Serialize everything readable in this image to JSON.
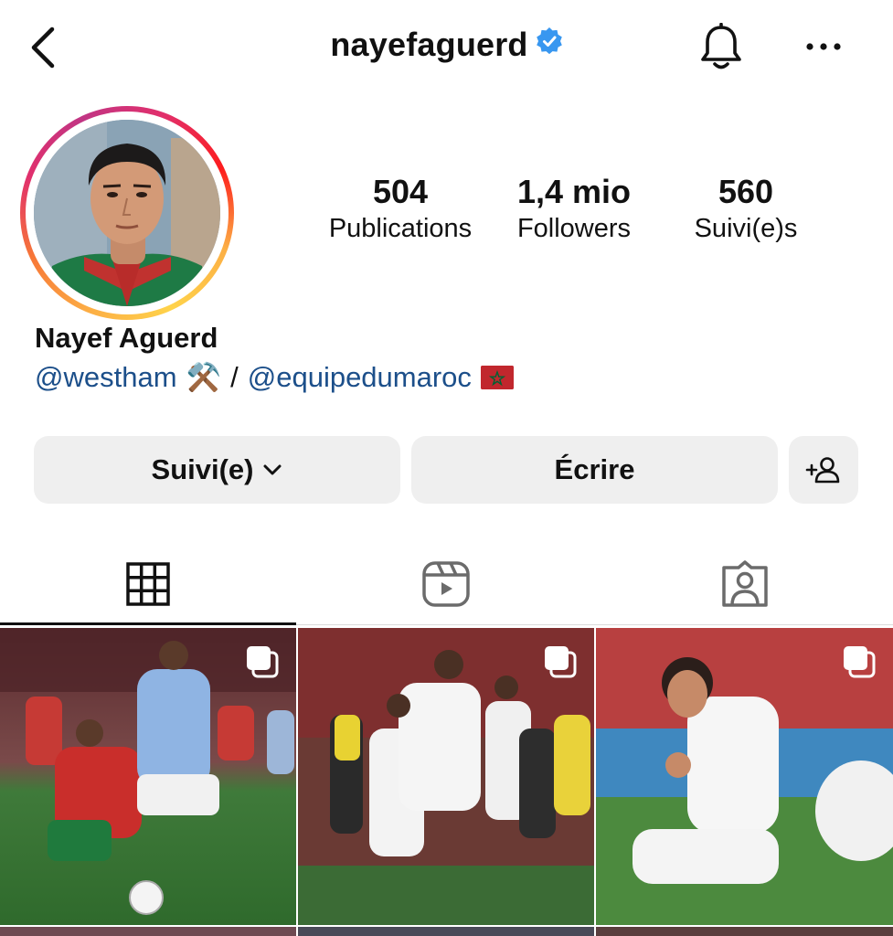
{
  "header": {
    "username": "nayefaguerd",
    "back_icon": "chevron-left-icon",
    "verified_icon": "verified-badge-icon",
    "bell_icon": "bell-icon",
    "more_icon": "more-horizontal-icon",
    "verified_color": "#3897f0"
  },
  "profile": {
    "stats": [
      {
        "value": "504",
        "label": "Publications"
      },
      {
        "value": "1,4 mio",
        "label": "Followers"
      },
      {
        "value": "560",
        "label": "Suivi(e)s"
      }
    ],
    "full_name": "Nayef Aguerd",
    "bio": {
      "link1": "@westham",
      "emoji1": "⚒️",
      "separator": "/",
      "link2": "@equipedumaroc",
      "flag": "morocco-flag"
    },
    "link_color": "#1c4f8a"
  },
  "actions": {
    "follow_label": "Suivi(e)",
    "message_label": "Écrire",
    "add_user_icon": "add-user-icon"
  },
  "tabs": [
    {
      "name": "posts-grid",
      "icon": "grid-icon",
      "active": true
    },
    {
      "name": "reels",
      "icon": "reels-icon",
      "active": false
    },
    {
      "name": "tagged",
      "icon": "tagged-person-icon",
      "active": false
    }
  ],
  "posts": [
    {
      "icon": "carousel-icon"
    },
    {
      "icon": "carousel-icon"
    },
    {
      "icon": "carousel-icon"
    }
  ]
}
